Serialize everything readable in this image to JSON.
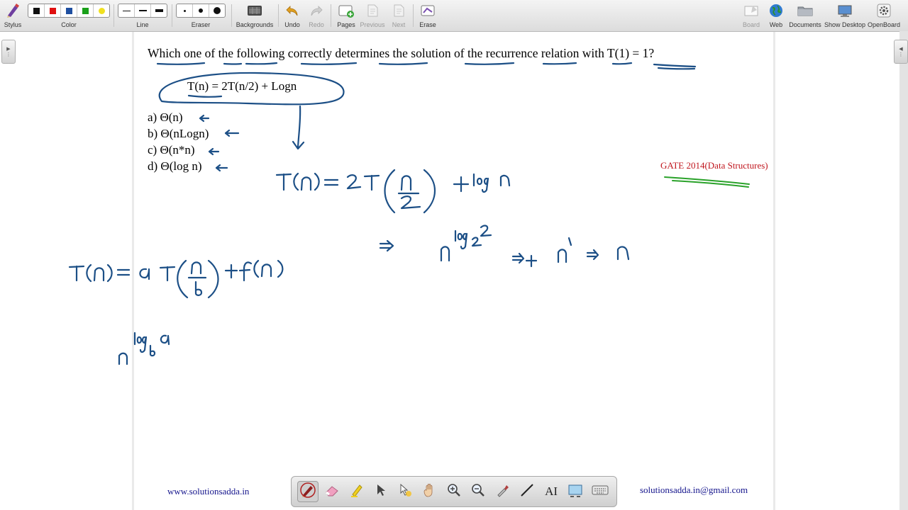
{
  "toolbar": {
    "stylus": "Stylus",
    "color": "Color",
    "line": "Line",
    "eraser": "Eraser",
    "backgrounds": "Backgrounds",
    "undo": "Undo",
    "redo": "Redo",
    "pages": "Pages",
    "previous": "Previous",
    "next": "Next",
    "erase": "Erase",
    "board": "Board",
    "web": "Web",
    "documents": "Documents",
    "show_desktop": "Show Desktop",
    "openboard": "OpenBoard"
  },
  "colors": {
    "swatches": [
      "#111111",
      "#e01010",
      "#1f4fa0",
      "#1aa01a",
      "#f0e020"
    ],
    "ink_blue": "#1c4f86",
    "ink_green": "#2aa22a",
    "gate_red": "#c0161e",
    "footer_blue": "#14148c"
  },
  "board": {
    "question": "Which one of the following correctly determines the solution of the recurrence relation with T(1) = 1?",
    "formula": "T(n) = 2T(n/2) + Logn",
    "options": [
      "a) Θ(n)",
      "b) Θ(nLogn)",
      "c) Θ(n*n)",
      "d) Θ(log n)"
    ],
    "gate_label": "GATE 2014(Data Structures)",
    "footer_left": "www.solutionsadda.in",
    "footer_right": "solutionsadda.in@gmail.com"
  },
  "bottom_tools": [
    "pen-icon",
    "eraser-icon",
    "highlighter-icon",
    "pointer-icon",
    "laser-pointer-icon",
    "hand-icon",
    "zoom-in-icon",
    "zoom-out-icon",
    "pipette-icon",
    "line-icon",
    "text-icon",
    "capture-icon",
    "keyboard-icon"
  ]
}
